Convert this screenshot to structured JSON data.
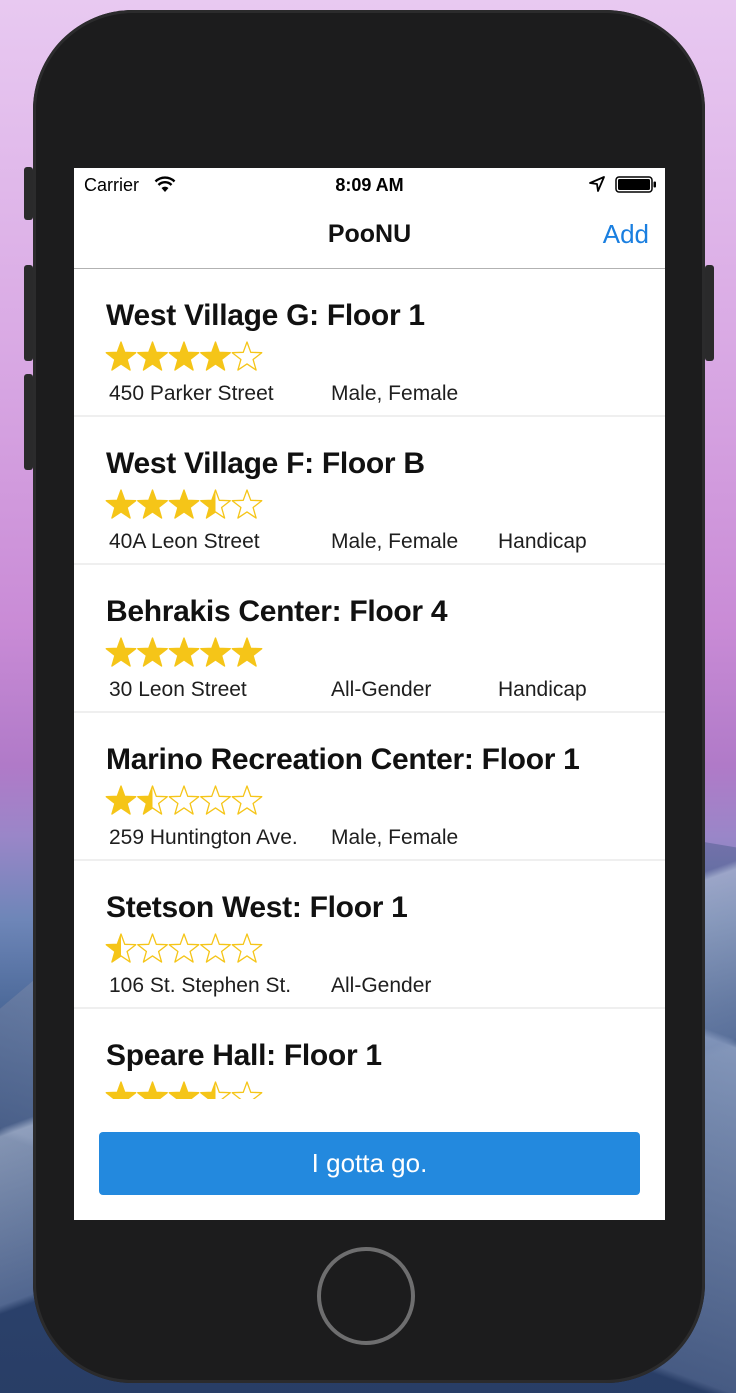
{
  "status_bar": {
    "carrier": "Carrier",
    "time": "8:09 AM",
    "icons": [
      "wifi-icon",
      "location-icon",
      "battery-icon"
    ]
  },
  "nav": {
    "title": "PooNU",
    "add_label": "Add"
  },
  "colors": {
    "accent": "#1a7fe0",
    "star": "#f5c518",
    "button": "#2389de"
  },
  "bathrooms": [
    {
      "title": "West Village G: Floor 1",
      "rating": 4,
      "address": "450 Parker Street",
      "gender": "Male, Female",
      "access": ""
    },
    {
      "title": "West Village F: Floor B",
      "rating": 3.5,
      "address": "40A Leon Street",
      "gender": "Male, Female",
      "access": "Handicap"
    },
    {
      "title": "Behrakis Center: Floor 4",
      "rating": 5,
      "address": "30 Leon Street",
      "gender": "All-Gender",
      "access": "Handicap"
    },
    {
      "title": "Marino Recreation Center: Floor 1",
      "rating": 1.5,
      "address": "259 Huntington Ave.",
      "gender": "Male, Female",
      "access": ""
    },
    {
      "title": "Stetson West: Floor 1",
      "rating": 0.5,
      "address": "106 St. Stephen St.",
      "gender": "All-Gender",
      "access": ""
    },
    {
      "title": "Speare Hall: Floor 1",
      "rating": 3.5,
      "address": "",
      "gender": "",
      "access": ""
    }
  ],
  "go_button_label": "I gotta go."
}
